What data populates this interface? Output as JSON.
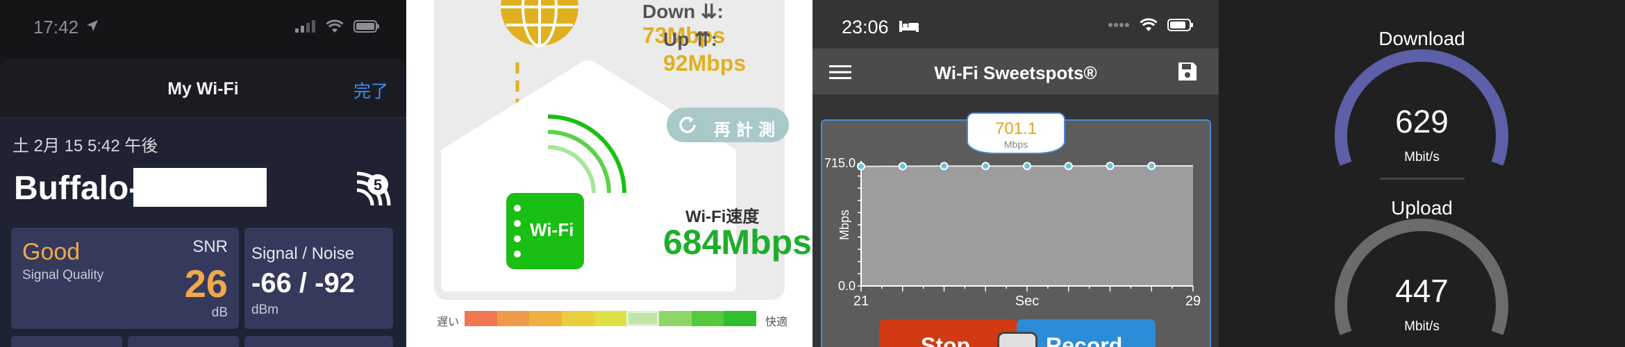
{
  "panel1": {
    "status_time": "17:42",
    "sheet_title": "My Wi-Fi",
    "done_label": "完了",
    "date": "土 2月 15 5:42 午後",
    "ssid": "Buffalo-",
    "wifi_generation": "5",
    "quality": "Good",
    "quality_label": "Signal Quality",
    "snr_label": "SNR",
    "snr_value": "26",
    "snr_unit": "dB",
    "signal_noise_label": "Signal / Noise",
    "signal_noise_value": "-66 / -92",
    "signal_noise_unit": "dBm"
  },
  "panel2": {
    "down_label": "Down ⇊:",
    "down_value": "73Mbps",
    "up_label": "Up ⇈:",
    "up_value": "92Mbps",
    "retest_label": "再計測",
    "router_label": "Wi-Fi",
    "speed_label": "Wi-Fi速度",
    "speed_value": "684Mbps",
    "slow_label": "遅い",
    "fast_label": "快適",
    "scale_colors": [
      "#ef7752",
      "#ef9a48",
      "#f0b040",
      "#e9cf3c",
      "#dfe046",
      "#c2e6a8",
      "#8fd668",
      "#58c83c",
      "#2ebe2e"
    ],
    "scale_marker_index": 5
  },
  "panel3": {
    "status_time": "23:06",
    "title": "Wi-Fi Sweetspots®",
    "callout_value": "701.1",
    "callout_unit": "Mbps",
    "stop_label": "Stop",
    "record_label": "Record",
    "chart_data": {
      "type": "area",
      "x": [
        21,
        22,
        23,
        24,
        25,
        26,
        27,
        28,
        29
      ],
      "values": [
        700,
        701,
        702,
        702,
        702,
        702,
        703,
        703,
        703
      ],
      "xlabel": "Sec",
      "ylabel": "Mbps",
      "ylim": [
        0,
        715
      ],
      "ytick_labels": [
        "715.0",
        "0.0"
      ],
      "xtick_labels": [
        "21",
        "Sec",
        "29"
      ]
    }
  },
  "panel4": {
    "download_title": "Download",
    "download_value": "629",
    "download_unit": "Mbit/s",
    "upload_title": "Upload",
    "upload_value": "447",
    "upload_unit": "Mbit/s",
    "download_color": "#5d5fa8",
    "upload_color": "#6b6b6b"
  }
}
